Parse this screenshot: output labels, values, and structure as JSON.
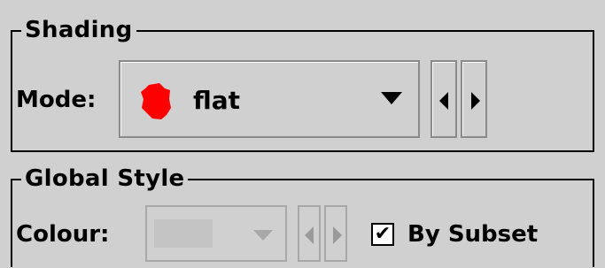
{
  "shading": {
    "title": "Shading",
    "mode_label": "Mode:",
    "mode_value": "flat",
    "mode_swatch_color": "#ff0000",
    "prev_icon": "triangle-left-icon",
    "next_icon": "triangle-right-icon"
  },
  "global_style": {
    "title": "Global Style",
    "colour_label": "Colour:",
    "colour_enabled": false,
    "by_subset_label": "By Subset",
    "by_subset_checked": true,
    "check_mark": "✔"
  }
}
